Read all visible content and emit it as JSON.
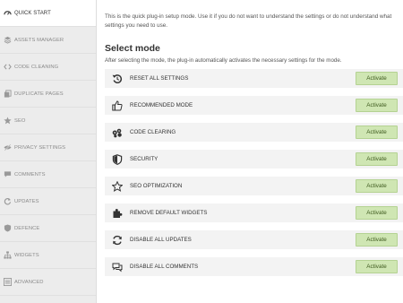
{
  "sidebar": {
    "items": [
      {
        "label": "QUICK START",
        "icon": "gauge-icon",
        "active": true
      },
      {
        "label": "ASSETS MANAGER",
        "icon": "layers-icon",
        "active": false
      },
      {
        "label": "CODE CLEANING",
        "icon": "code-icon",
        "active": false
      },
      {
        "label": "DUPLICATE PAGES",
        "icon": "duplicate-icon",
        "active": false
      },
      {
        "label": "SEO",
        "icon": "star-icon",
        "active": false
      },
      {
        "label": "PRIVACY SETTINGS",
        "icon": "eye-slash-icon",
        "active": false
      },
      {
        "label": "COMMENTS",
        "icon": "comment-icon",
        "active": false
      },
      {
        "label": "UPDATES",
        "icon": "refresh-icon",
        "active": false
      },
      {
        "label": "DEFENCE",
        "icon": "shield-icon",
        "active": false
      },
      {
        "label": "WIDGETS",
        "icon": "sitemap-icon",
        "active": false
      },
      {
        "label": "ADVANCED",
        "icon": "list-icon",
        "active": false
      }
    ]
  },
  "main": {
    "intro": "This is the quick plug-in setup mode. Use it if you do not want to understand the settings or do not understand what settings you need to use.",
    "section_title": "Select mode",
    "section_desc": "After selecting the mode, the plug-in automatically activates the necessary settings for the mode.",
    "modes": [
      {
        "label": "RESET ALL SETTINGS",
        "icon": "undo-icon",
        "button": "Activate"
      },
      {
        "label": "RECOMMENDED MODE",
        "icon": "thumbs-up-icon",
        "button": "Activate"
      },
      {
        "label": "CODE CLEARING",
        "icon": "broom-icon",
        "button": "Activate"
      },
      {
        "label": "SECURITY",
        "icon": "shield-icon",
        "button": "Activate"
      },
      {
        "label": "SEO OPTIMIZATION",
        "icon": "star-outline-icon",
        "button": "Activate"
      },
      {
        "label": "REMOVE DEFAULT WIDGETS",
        "icon": "puzzle-icon",
        "button": "Activate"
      },
      {
        "label": "DISABLE ALL UPDATES",
        "icon": "refresh-icon",
        "button": "Activate"
      },
      {
        "label": "DISABLE ALL COMMENTS",
        "icon": "comments-icon",
        "button": "Activate"
      }
    ]
  },
  "colors": {
    "activate_bg": "#cfe6b3",
    "activate_border": "#b4d292",
    "sidebar_bg": "#ececec",
    "row_bg": "#f3f3f3"
  }
}
